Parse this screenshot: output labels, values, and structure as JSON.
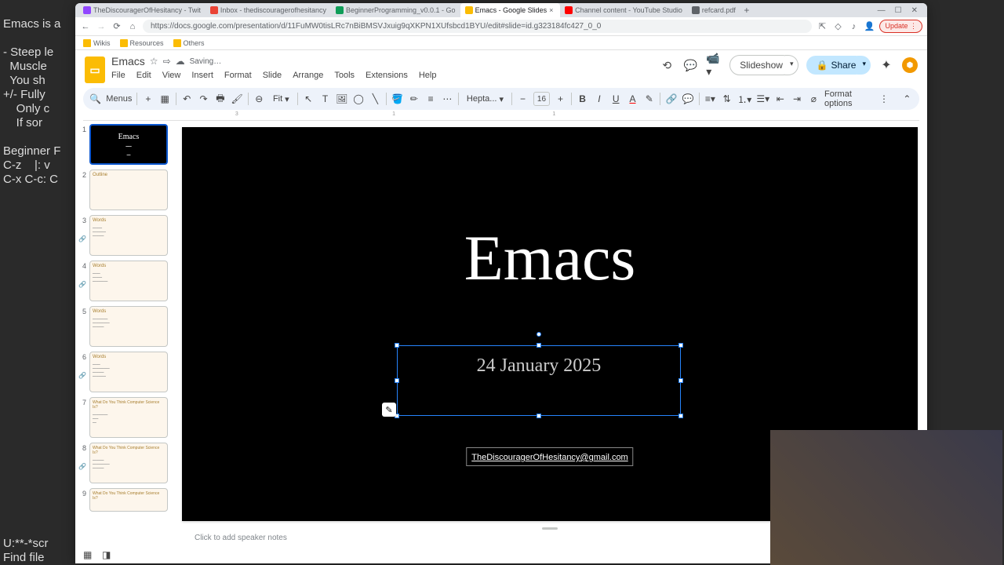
{
  "terminal": {
    "lines": [
      "Emacs is a",
      "",
      "- Steep le",
      "  Muscle",
      "  You sh",
      "+/- Fully",
      "    Only c",
      "    If sor",
      "",
      "Beginner F",
      "C-z    |: v",
      "C-x C-c: C"
    ],
    "bottom1": "U:**-*scr",
    "bottom2": "Find file"
  },
  "tabs": [
    {
      "label": "TheDiscouragerOfHesitancy - Twit",
      "favicon": "#9146ff"
    },
    {
      "label": "Inbox - thediscouragerofhesitancy",
      "favicon": "#ea4335"
    },
    {
      "label": "BeginnerProgramming_v0.0.1 - Go",
      "favicon": "#0f9d58"
    },
    {
      "label": "Emacs - Google Slides",
      "favicon": "#fbbc04",
      "active": true
    },
    {
      "label": "Channel content - YouTube Studio",
      "favicon": "#ff0000"
    },
    {
      "label": "refcard.pdf",
      "favicon": "#5f6368"
    }
  ],
  "url": "https://docs.google.com/presentation/d/11FuMW0tisLRc7nBiBMSVJxuig9qXKPN1XUfsbcd1BYU/edit#slide=id.g323184fc427_0_0",
  "bookmarks": [
    {
      "label": "Wikis"
    },
    {
      "label": "Resources"
    },
    {
      "label": "Others"
    }
  ],
  "doc": {
    "title": "Emacs",
    "saving": "Saving…",
    "menu": [
      "File",
      "Edit",
      "View",
      "Insert",
      "Format",
      "Slide",
      "Arrange",
      "Tools",
      "Extensions",
      "Help"
    ],
    "slideshow": "Slideshow",
    "share": "Share"
  },
  "toolbar": {
    "menus": "Menus",
    "zoom": "Fit",
    "font": "Hepta...",
    "fontsize": "16",
    "format_options": "Format options"
  },
  "thumbs": [
    {
      "n": "1",
      "title": "Emacs",
      "type": "black",
      "selected": true
    },
    {
      "n": "2",
      "title": "Outline",
      "type": "cream"
    },
    {
      "n": "3",
      "title": "Words",
      "type": "cream",
      "attach": true
    },
    {
      "n": "4",
      "title": "Words",
      "type": "cream",
      "attach": true
    },
    {
      "n": "5",
      "title": "Words",
      "type": "cream"
    },
    {
      "n": "6",
      "title": "Words",
      "type": "cream",
      "attach": true
    },
    {
      "n": "7",
      "title": "What Do You Think Computer Science Is?",
      "type": "cream"
    },
    {
      "n": "8",
      "title": "What Do You Think Computer Science Is?",
      "type": "cream",
      "attach": true
    },
    {
      "n": "9",
      "title": "What Do You Think Computer Science Is?",
      "type": "cream"
    }
  ],
  "slide": {
    "title": "Emacs",
    "date": "24 January 2025",
    "email": "TheDiscouragerOfHesitancy@gmail.com"
  },
  "notes": {
    "placeholder": "Click to add speaker notes"
  },
  "update": "Update"
}
